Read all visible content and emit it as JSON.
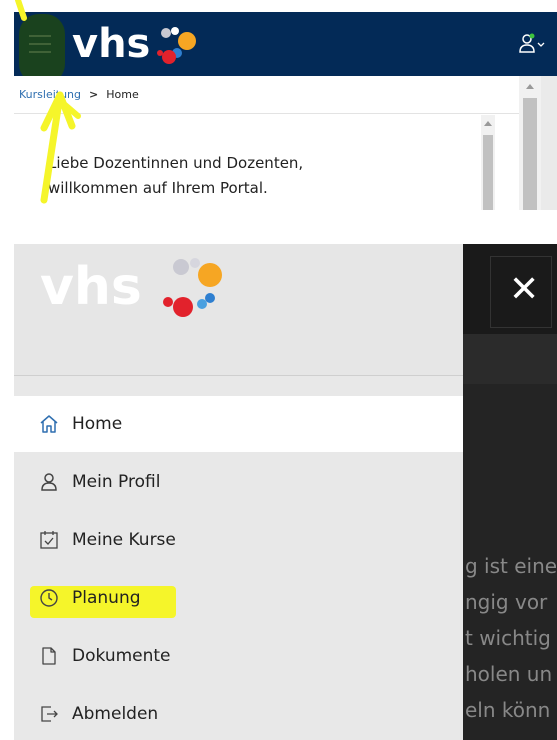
{
  "top_screen": {
    "brand": "vhs",
    "breadcrumb": {
      "link": "Kursleitung",
      "separator": ">",
      "current": "Home"
    },
    "welcome_line_1": "Liebe Dozentinnen und Dozenten,",
    "welcome_line_2": "willkommen auf Ihrem Portal."
  },
  "drawer": {
    "brand": "vhs",
    "close_symbol": "✕",
    "items": [
      {
        "label": "Home",
        "icon": "home-icon"
      },
      {
        "label": "Mein Profil",
        "icon": "user-icon"
      },
      {
        "label": "Meine Kurse",
        "icon": "calendar-check-icon"
      },
      {
        "label": "Planung",
        "icon": "clock-icon"
      },
      {
        "label": "Dokumente",
        "icon": "document-icon"
      },
      {
        "label": "Abmelden",
        "icon": "logout-icon"
      }
    ]
  },
  "background_text": [
    "g ist eine",
    "ngig vor",
    "t wichtig",
    "holen un",
    "eln könn"
  ],
  "colors": {
    "header_navy": "#032a57",
    "highlight_yellow": "#f5f52a",
    "logo_orange": "#f6a623",
    "logo_red": "#e2222c",
    "logo_blue": "#2e7fd0",
    "logo_grey": "#c9c9d2"
  }
}
